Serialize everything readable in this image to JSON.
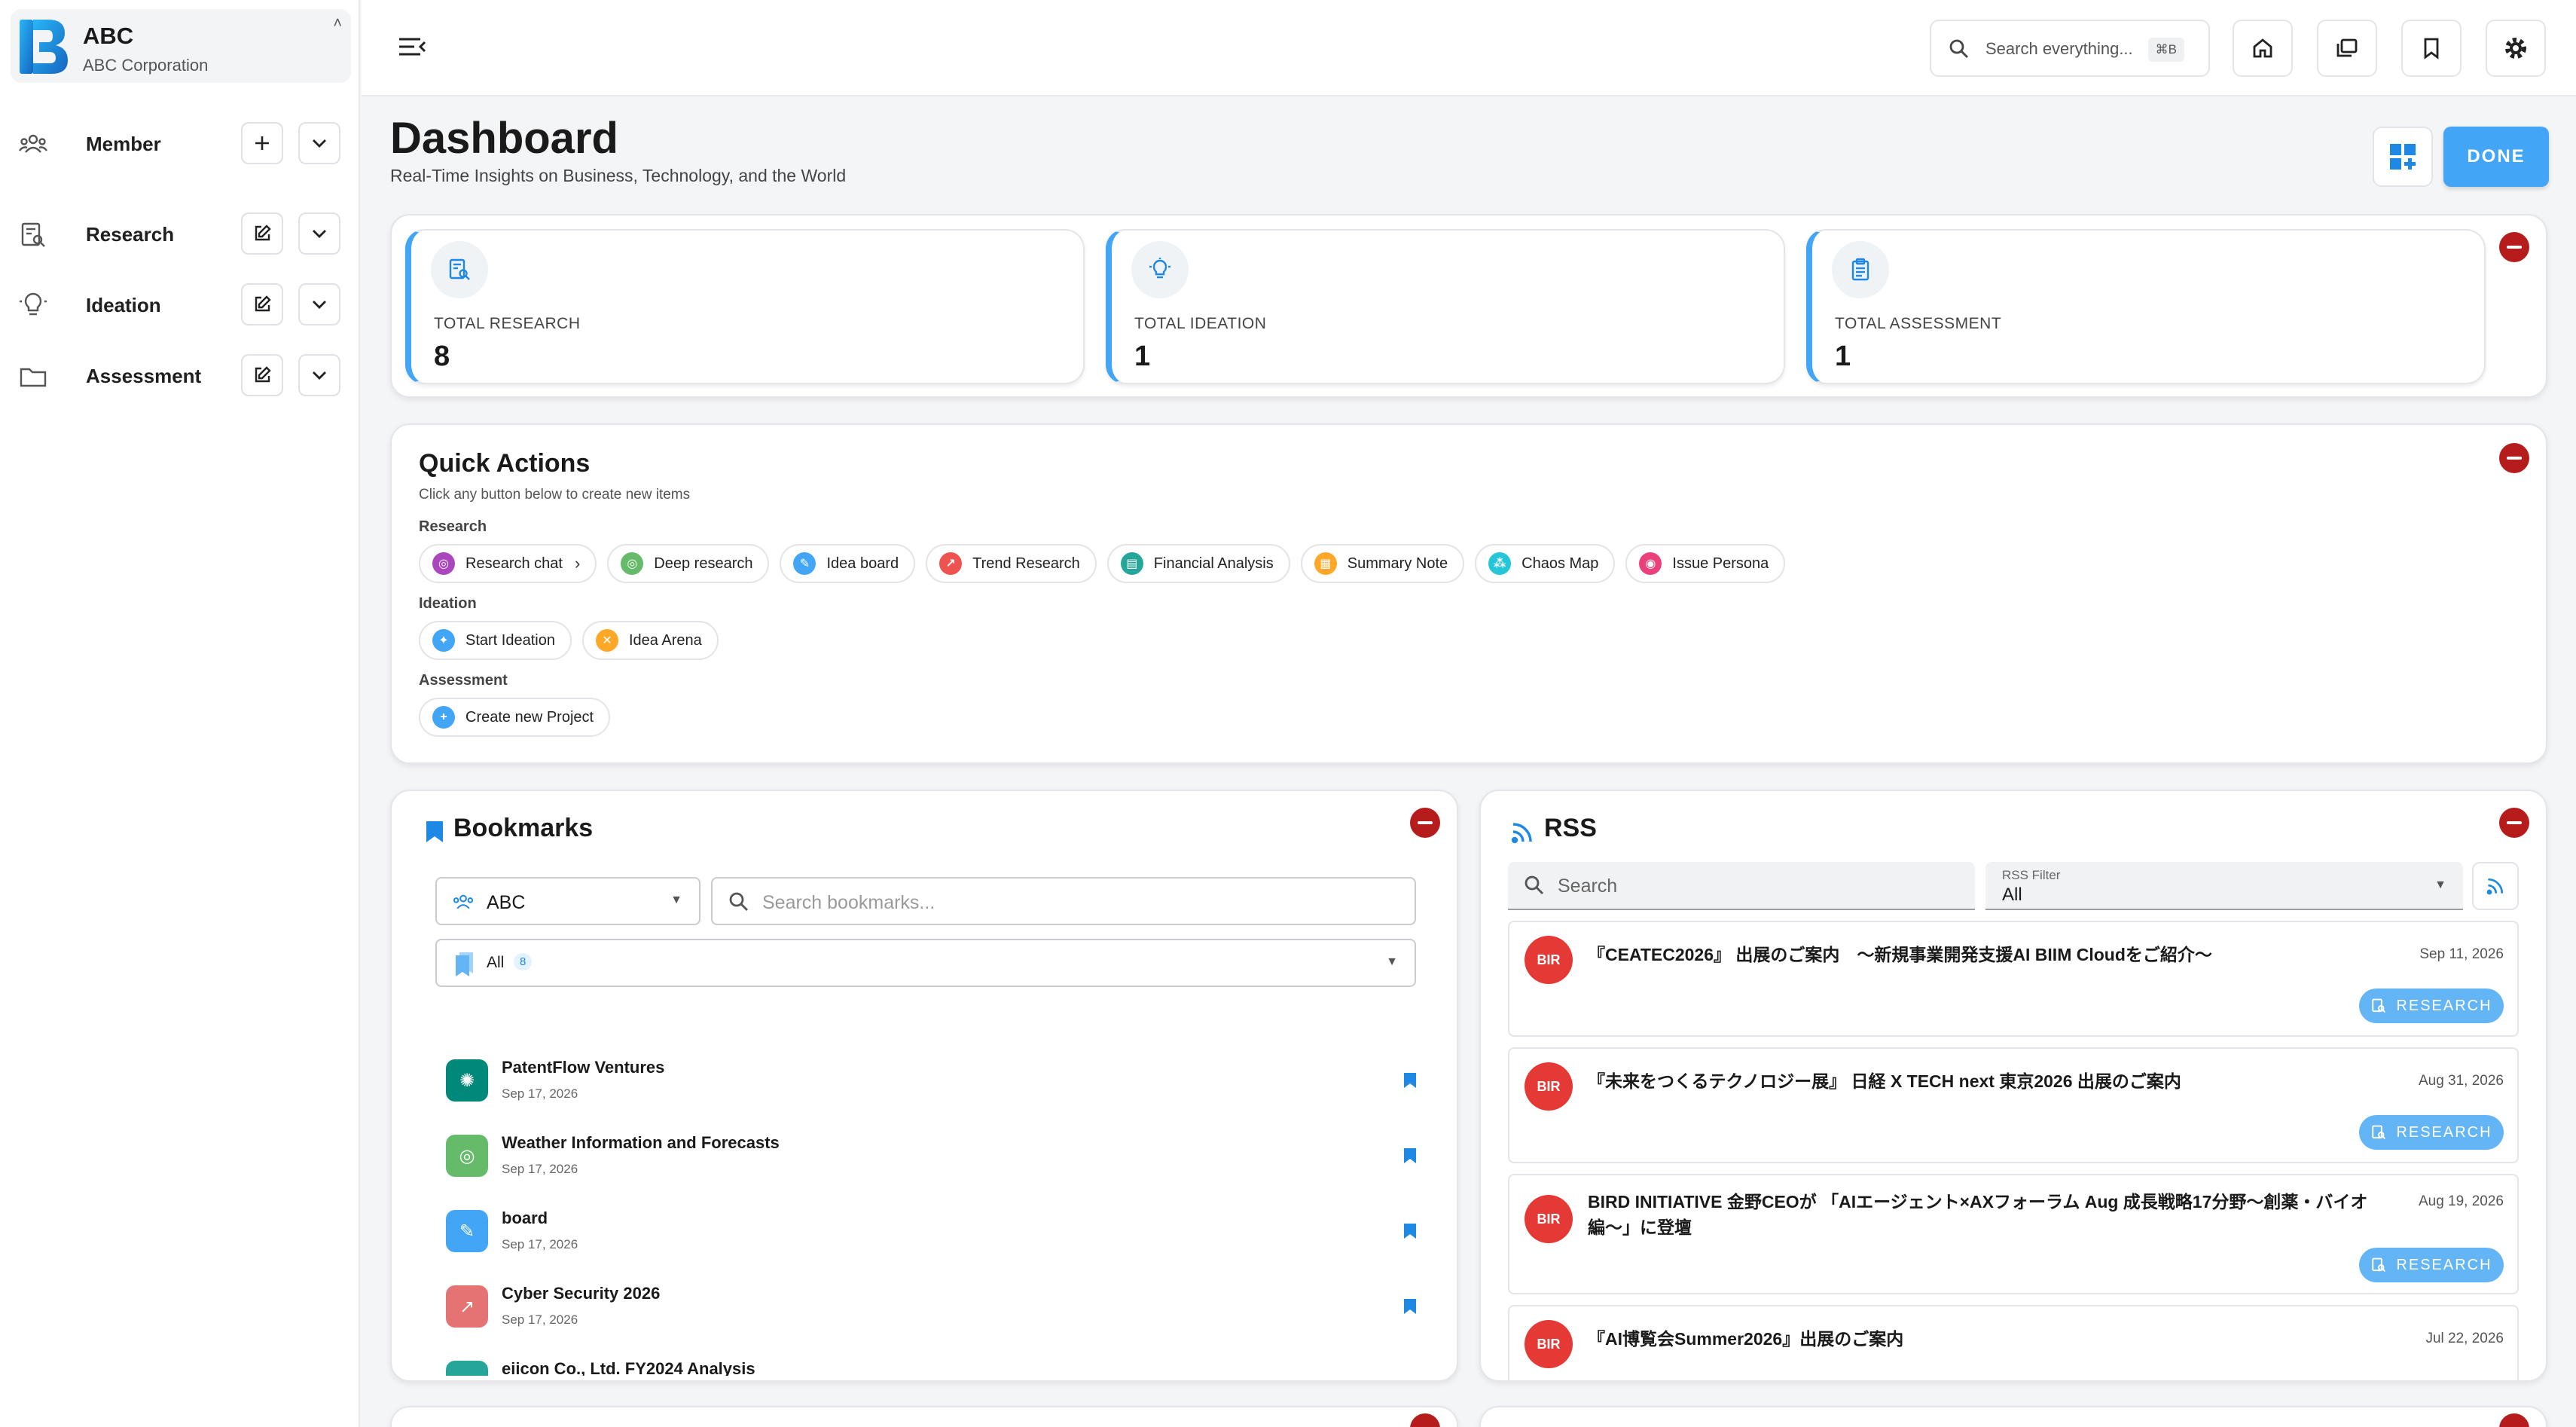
{
  "org": {
    "name": "ABC",
    "subtitle": "ABC Corporation"
  },
  "sidebar": {
    "items": [
      {
        "label": "Member",
        "icon": "people-icon",
        "action": "add"
      },
      {
        "label": "Research",
        "icon": "research-icon",
        "action": "edit"
      },
      {
        "label": "Ideation",
        "icon": "lightbulb-icon",
        "action": "edit"
      },
      {
        "label": "Assessment",
        "icon": "folder-icon",
        "action": "edit"
      }
    ]
  },
  "topbar": {
    "search_placeholder": "Search everything...",
    "shortcut": "⌘B"
  },
  "header": {
    "title": "Dashboard",
    "subtitle": "Real-Time Insights on Business, Technology, and the World",
    "done_label": "DONE"
  },
  "stats": [
    {
      "label": "TOTAL RESEARCH",
      "value": "8"
    },
    {
      "label": "TOTAL IDEATION",
      "value": "1"
    },
    {
      "label": "TOTAL ASSESSMENT",
      "value": "1"
    }
  ],
  "quick_actions": {
    "title": "Quick Actions",
    "subtitle": "Click any button below to create new items",
    "sections": [
      {
        "label": "Research",
        "chips": [
          {
            "label": "Research chat",
            "color": "#ab47bc"
          },
          {
            "label": "Deep research",
            "color": "#66bb6a"
          },
          {
            "label": "Idea board",
            "color": "#42a5f5"
          },
          {
            "label": "Trend Research",
            "color": "#ef5350"
          },
          {
            "label": "Financial Analysis",
            "color": "#26a69a"
          },
          {
            "label": "Summary Note",
            "color": "#ffa726"
          },
          {
            "label": "Chaos Map",
            "color": "#26c6da"
          },
          {
            "label": "Issue Persona",
            "color": "#ec407a"
          }
        ]
      },
      {
        "label": "Ideation",
        "chips": [
          {
            "label": "Start Ideation",
            "color": "#42a5f5"
          },
          {
            "label": "Idea Arena",
            "color": "#ffa726"
          }
        ]
      },
      {
        "label": "Assessment",
        "chips": [
          {
            "label": "Create new Project",
            "color": "#42a5f5"
          }
        ]
      }
    ]
  },
  "bookmarks": {
    "title": "Bookmarks",
    "org_select": "ABC",
    "search_placeholder": "Search bookmarks...",
    "filter": "All",
    "filter_count": "8",
    "items": [
      {
        "title": "PatentFlow Ventures",
        "date": "Sep 17, 2026",
        "color": "#00897b"
      },
      {
        "title": "Weather Information and Forecasts",
        "date": "Sep 17, 2026",
        "color": "#66bb6a"
      },
      {
        "title": "board",
        "date": "Sep 17, 2026",
        "color": "#42a5f5"
      },
      {
        "title": "Cyber Security 2026",
        "date": "Sep 17, 2026",
        "color": "#e57373"
      },
      {
        "title": "eiicon Co., Ltd. FY2024 Analysis",
        "date": "",
        "color": "#26a69a"
      }
    ]
  },
  "rss": {
    "title": "RSS",
    "search_placeholder": "Search",
    "filter_label": "RSS Filter",
    "filter_value": "All",
    "button_label": "RESEARCH",
    "items": [
      {
        "badge": "BIR",
        "title": "『CEATEC2026』 出展のご案内　～新規事業開発支援AI BIIM Cloudをご紹介～",
        "date": "Sep 11, 2026"
      },
      {
        "badge": "BIR",
        "title": "『未来をつくるテクノロジー展』 日経 X TECH next 東京2026 出展のご案内",
        "date": "Aug 31, 2026"
      },
      {
        "badge": "BIR",
        "title_line1": "BIRD INITIATIVE 金野CEOが 「AIエージェント×AXフォーラム Aug 成長戦略17分野～創薬・バイオ",
        "title_line2": "編～」に登壇",
        "date": "Aug 19, 2026"
      },
      {
        "badge": "BIR",
        "title": "『AI博覧会Summer2026』出展のご案内",
        "date": "Jul 22, 2026"
      }
    ]
  }
}
